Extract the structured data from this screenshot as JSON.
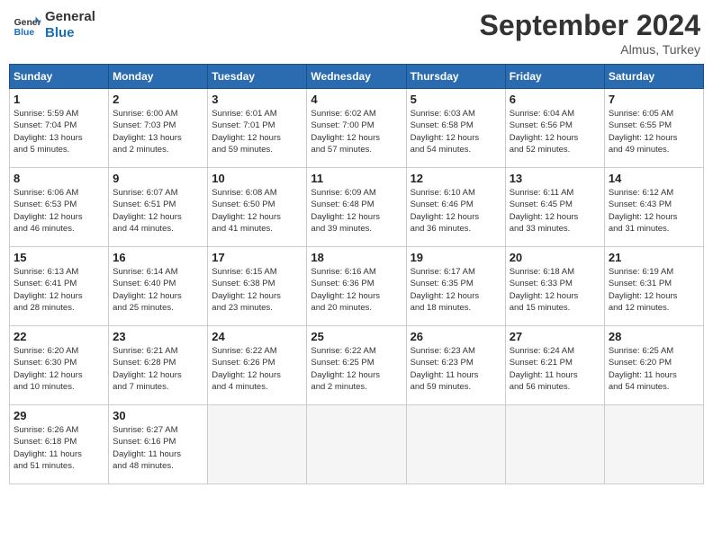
{
  "header": {
    "logo": {
      "line1": "General",
      "line2": "Blue"
    },
    "title": "September 2024",
    "subtitle": "Almus, Turkey"
  },
  "weekdays": [
    "Sunday",
    "Monday",
    "Tuesday",
    "Wednesday",
    "Thursday",
    "Friday",
    "Saturday"
  ],
  "weeks": [
    [
      {
        "day": "1",
        "info": "Sunrise: 5:59 AM\nSunset: 7:04 PM\nDaylight: 13 hours\nand 5 minutes."
      },
      {
        "day": "2",
        "info": "Sunrise: 6:00 AM\nSunset: 7:03 PM\nDaylight: 13 hours\nand 2 minutes."
      },
      {
        "day": "3",
        "info": "Sunrise: 6:01 AM\nSunset: 7:01 PM\nDaylight: 12 hours\nand 59 minutes."
      },
      {
        "day": "4",
        "info": "Sunrise: 6:02 AM\nSunset: 7:00 PM\nDaylight: 12 hours\nand 57 minutes."
      },
      {
        "day": "5",
        "info": "Sunrise: 6:03 AM\nSunset: 6:58 PM\nDaylight: 12 hours\nand 54 minutes."
      },
      {
        "day": "6",
        "info": "Sunrise: 6:04 AM\nSunset: 6:56 PM\nDaylight: 12 hours\nand 52 minutes."
      },
      {
        "day": "7",
        "info": "Sunrise: 6:05 AM\nSunset: 6:55 PM\nDaylight: 12 hours\nand 49 minutes."
      }
    ],
    [
      {
        "day": "8",
        "info": "Sunrise: 6:06 AM\nSunset: 6:53 PM\nDaylight: 12 hours\nand 46 minutes."
      },
      {
        "day": "9",
        "info": "Sunrise: 6:07 AM\nSunset: 6:51 PM\nDaylight: 12 hours\nand 44 minutes."
      },
      {
        "day": "10",
        "info": "Sunrise: 6:08 AM\nSunset: 6:50 PM\nDaylight: 12 hours\nand 41 minutes."
      },
      {
        "day": "11",
        "info": "Sunrise: 6:09 AM\nSunset: 6:48 PM\nDaylight: 12 hours\nand 39 minutes."
      },
      {
        "day": "12",
        "info": "Sunrise: 6:10 AM\nSunset: 6:46 PM\nDaylight: 12 hours\nand 36 minutes."
      },
      {
        "day": "13",
        "info": "Sunrise: 6:11 AM\nSunset: 6:45 PM\nDaylight: 12 hours\nand 33 minutes."
      },
      {
        "day": "14",
        "info": "Sunrise: 6:12 AM\nSunset: 6:43 PM\nDaylight: 12 hours\nand 31 minutes."
      }
    ],
    [
      {
        "day": "15",
        "info": "Sunrise: 6:13 AM\nSunset: 6:41 PM\nDaylight: 12 hours\nand 28 minutes."
      },
      {
        "day": "16",
        "info": "Sunrise: 6:14 AM\nSunset: 6:40 PM\nDaylight: 12 hours\nand 25 minutes."
      },
      {
        "day": "17",
        "info": "Sunrise: 6:15 AM\nSunset: 6:38 PM\nDaylight: 12 hours\nand 23 minutes."
      },
      {
        "day": "18",
        "info": "Sunrise: 6:16 AM\nSunset: 6:36 PM\nDaylight: 12 hours\nand 20 minutes."
      },
      {
        "day": "19",
        "info": "Sunrise: 6:17 AM\nSunset: 6:35 PM\nDaylight: 12 hours\nand 18 minutes."
      },
      {
        "day": "20",
        "info": "Sunrise: 6:18 AM\nSunset: 6:33 PM\nDaylight: 12 hours\nand 15 minutes."
      },
      {
        "day": "21",
        "info": "Sunrise: 6:19 AM\nSunset: 6:31 PM\nDaylight: 12 hours\nand 12 minutes."
      }
    ],
    [
      {
        "day": "22",
        "info": "Sunrise: 6:20 AM\nSunset: 6:30 PM\nDaylight: 12 hours\nand 10 minutes."
      },
      {
        "day": "23",
        "info": "Sunrise: 6:21 AM\nSunset: 6:28 PM\nDaylight: 12 hours\nand 7 minutes."
      },
      {
        "day": "24",
        "info": "Sunrise: 6:22 AM\nSunset: 6:26 PM\nDaylight: 12 hours\nand 4 minutes."
      },
      {
        "day": "25",
        "info": "Sunrise: 6:22 AM\nSunset: 6:25 PM\nDaylight: 12 hours\nand 2 minutes."
      },
      {
        "day": "26",
        "info": "Sunrise: 6:23 AM\nSunset: 6:23 PM\nDaylight: 11 hours\nand 59 minutes."
      },
      {
        "day": "27",
        "info": "Sunrise: 6:24 AM\nSunset: 6:21 PM\nDaylight: 11 hours\nand 56 minutes."
      },
      {
        "day": "28",
        "info": "Sunrise: 6:25 AM\nSunset: 6:20 PM\nDaylight: 11 hours\nand 54 minutes."
      }
    ],
    [
      {
        "day": "29",
        "info": "Sunrise: 6:26 AM\nSunset: 6:18 PM\nDaylight: 11 hours\nand 51 minutes."
      },
      {
        "day": "30",
        "info": "Sunrise: 6:27 AM\nSunset: 6:16 PM\nDaylight: 11 hours\nand 48 minutes."
      },
      null,
      null,
      null,
      null,
      null
    ]
  ]
}
